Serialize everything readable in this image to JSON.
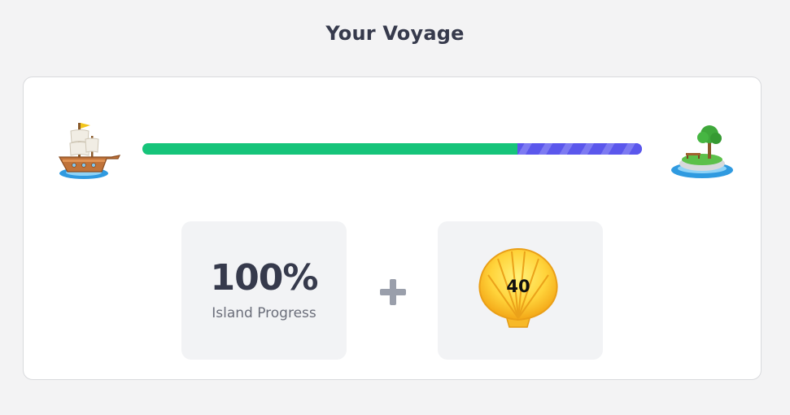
{
  "header": {
    "title": "Your Voyage"
  },
  "voyage": {
    "start_icon": "pirate-ship-icon",
    "end_icon": "tree-island-icon",
    "progress": {
      "completed_fraction": 0.75,
      "in_progress_fraction": 0.25,
      "completed_color": "#16c47a",
      "in_progress_color": "#5b57ec"
    }
  },
  "stats": {
    "island_progress": {
      "value": "100%",
      "label": "Island Progress"
    },
    "operator_icon": "plus-icon",
    "shells": {
      "icon": "scallop-shell-icon",
      "count": "40"
    }
  }
}
